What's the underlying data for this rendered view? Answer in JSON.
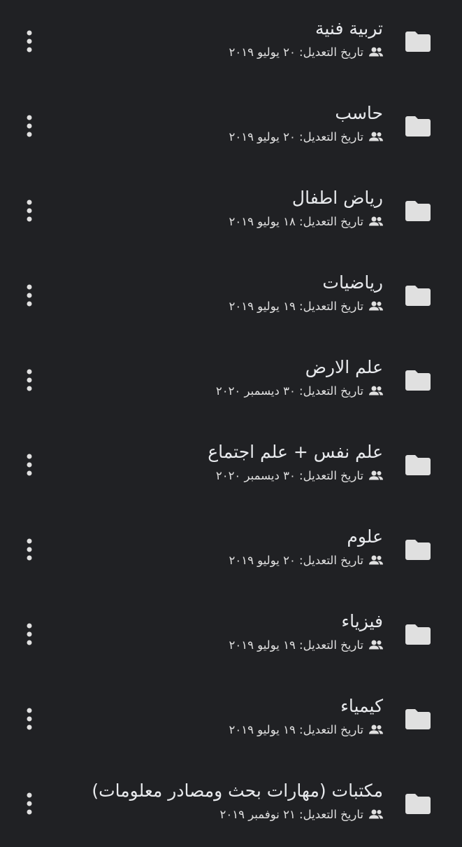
{
  "icons": {
    "folder": "folder-icon",
    "shared": "shared-people-icon",
    "more": "more-vert-icon"
  },
  "colors": {
    "background": "#202124",
    "text": "#e8eaed",
    "icon": "#e0e0e0"
  },
  "items": [
    {
      "title": "تربية فنية",
      "meta": "تاريخ التعديل: ٢٠ يوليو ٢٠١٩"
    },
    {
      "title": "حاسب",
      "meta": "تاريخ التعديل: ٢٠ يوليو ٢٠١٩"
    },
    {
      "title": "رياض اطفال",
      "meta": "تاريخ التعديل: ١٨ يوليو ٢٠١٩"
    },
    {
      "title": "رياضيات",
      "meta": "تاريخ التعديل: ١٩ يوليو ٢٠١٩"
    },
    {
      "title": "علم الارض",
      "meta": "تاريخ التعديل: ٣٠ ديسمبر ٢٠٢٠"
    },
    {
      "title": "علم نفس + علم اجتماع",
      "meta": "تاريخ التعديل: ٣٠ ديسمبر ٢٠٢٠"
    },
    {
      "title": "علوم",
      "meta": "تاريخ التعديل: ٢٠ يوليو ٢٠١٩"
    },
    {
      "title": "فيزياء",
      "meta": "تاريخ التعديل: ١٩ يوليو ٢٠١٩"
    },
    {
      "title": "كيمياء",
      "meta": "تاريخ التعديل: ١٩ يوليو ٢٠١٩"
    },
    {
      "title": "مكتبات (مهارات بحث ومصادر معلومات)",
      "meta": "تاريخ التعديل: ٢١ نوفمبر ٢٠١٩"
    }
  ]
}
